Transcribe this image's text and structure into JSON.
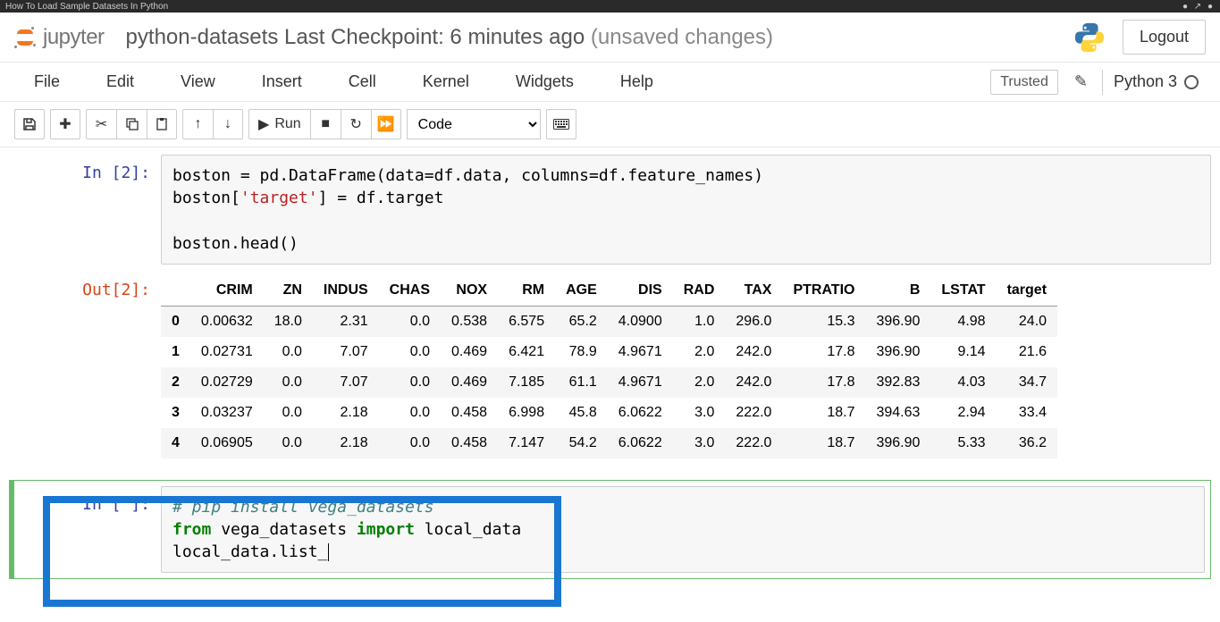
{
  "browser": {
    "tab_title": "How To Load Sample Datasets In Python"
  },
  "header": {
    "logo_text": "jupyter",
    "title": "python-datasets Last Checkpoint: 6 minutes ago",
    "unsaved": "  (unsaved changes)",
    "logout": "Logout"
  },
  "menu": {
    "file": "File",
    "edit": "Edit",
    "view": "View",
    "insert": "Insert",
    "cell": "Cell",
    "kernel": "Kernel",
    "widgets": "Widgets",
    "help": "Help",
    "trusted": "Trusted",
    "kernel_name": "Python 3"
  },
  "toolbar": {
    "run_label": "Run",
    "celltype": "Code"
  },
  "cells": {
    "in2_prompt": "In [2]:",
    "out2_prompt": "Out[2]:",
    "in_blank_prompt": "In [ ]:",
    "code2_line1_a": "boston ",
    "code2_line1_b": "=",
    "code2_line1_c": " pd.DataFrame(data",
    "code2_line1_d": "=",
    "code2_line1_e": "df.data, columns",
    "code2_line1_f": "=",
    "code2_line1_g": "df.feature_names)",
    "code2_line2_a": "boston[",
    "code2_line2_b": "'target'",
    "code2_line2_c": "] ",
    "code2_line2_d": "=",
    "code2_line2_e": " df.target",
    "code2_line4": "boston.head()",
    "code3_line1": "# pip install vega_datasets",
    "code3_line2_a": "from",
    "code3_line2_b": " vega_datasets ",
    "code3_line2_c": "import",
    "code3_line2_d": " local_data",
    "code3_line3": "local_data.list_"
  },
  "chart_data": {
    "type": "table",
    "columns": [
      "",
      "CRIM",
      "ZN",
      "INDUS",
      "CHAS",
      "NOX",
      "RM",
      "AGE",
      "DIS",
      "RAD",
      "TAX",
      "PTRATIO",
      "B",
      "LSTAT",
      "target"
    ],
    "rows": [
      [
        "0",
        "0.00632",
        "18.0",
        "2.31",
        "0.0",
        "0.538",
        "6.575",
        "65.2",
        "4.0900",
        "1.0",
        "296.0",
        "15.3",
        "396.90",
        "4.98",
        "24.0"
      ],
      [
        "1",
        "0.02731",
        "0.0",
        "7.07",
        "0.0",
        "0.469",
        "6.421",
        "78.9",
        "4.9671",
        "2.0",
        "242.0",
        "17.8",
        "396.90",
        "9.14",
        "21.6"
      ],
      [
        "2",
        "0.02729",
        "0.0",
        "7.07",
        "0.0",
        "0.469",
        "7.185",
        "61.1",
        "4.9671",
        "2.0",
        "242.0",
        "17.8",
        "392.83",
        "4.03",
        "34.7"
      ],
      [
        "3",
        "0.03237",
        "0.0",
        "2.18",
        "0.0",
        "0.458",
        "6.998",
        "45.8",
        "6.0622",
        "3.0",
        "222.0",
        "18.7",
        "394.63",
        "2.94",
        "33.4"
      ],
      [
        "4",
        "0.06905",
        "0.0",
        "2.18",
        "0.0",
        "0.458",
        "7.147",
        "54.2",
        "6.0622",
        "3.0",
        "222.0",
        "18.7",
        "396.90",
        "5.33",
        "36.2"
      ]
    ]
  }
}
